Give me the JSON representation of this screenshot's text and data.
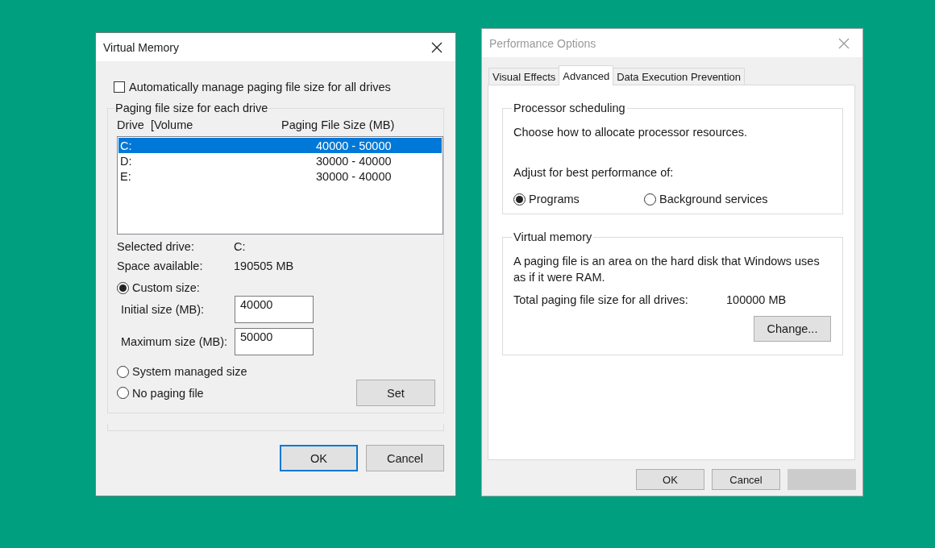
{
  "virtual_memory_dialog": {
    "title": "Virtual Memory",
    "active": true,
    "auto_manage": {
      "label": "Automatically manage paging file size for all drives",
      "checked": false
    },
    "group": {
      "legend": "Paging file size for each drive",
      "columns": [
        "Drive  [Volume",
        "Paging File Size (MB)"
      ],
      "rows": [
        {
          "drive": "C:",
          "size": "40000 - 50000",
          "selected": true
        },
        {
          "drive": "D:",
          "size": "30000 - 40000",
          "selected": false
        },
        {
          "drive": "E:",
          "size": "30000 - 40000",
          "selected": false
        }
      ],
      "selected_drive": {
        "label": "Selected drive:",
        "value": "C:"
      },
      "space_available": {
        "label": "Space available:",
        "value": "190505 MB"
      },
      "options": [
        {
          "kind": "custom",
          "label": "Custom size:",
          "selected": true
        },
        {
          "kind": "plain",
          "label": "System managed size",
          "selected": false
        },
        {
          "kind": "plain",
          "label": "No paging file",
          "selected": false
        }
      ],
      "initial_size": {
        "label": "Initial size (MB):",
        "value": "40000"
      },
      "maximum_size": {
        "label": "Maximum size (MB):",
        "value": "50000"
      },
      "set_button": "Set"
    },
    "buttons": [
      {
        "label": "OK",
        "focused": true
      },
      {
        "label": "Cancel",
        "focused": false
      }
    ]
  },
  "performance_options_dialog": {
    "title": "Performance Options",
    "active": false,
    "tabs": [
      {
        "label": "Visual Effects",
        "selected": false
      },
      {
        "label": "Advanced",
        "selected": true
      },
      {
        "label": "Data Execution Prevention",
        "selected": false
      }
    ],
    "processor_scheduling": {
      "legend": "Processor scheduling",
      "description": "Choose how to allocate processor resources.",
      "prompt": "Adjust for best performance of:",
      "options": [
        {
          "label": "Programs",
          "selected": true
        },
        {
          "label": "Background services",
          "selected": false
        }
      ]
    },
    "virtual_memory": {
      "legend": "Virtual memory",
      "description": "A paging file is an area on the hard disk that Windows uses as if it were RAM.",
      "total": {
        "label": "Total paging file size for all drives:",
        "value": "100000 MB"
      },
      "change_button": "Change..."
    },
    "buttons": [
      {
        "label": "OK",
        "disabled": false
      },
      {
        "label": "Cancel",
        "disabled": false
      },
      {
        "disabled": true
      }
    ]
  }
}
